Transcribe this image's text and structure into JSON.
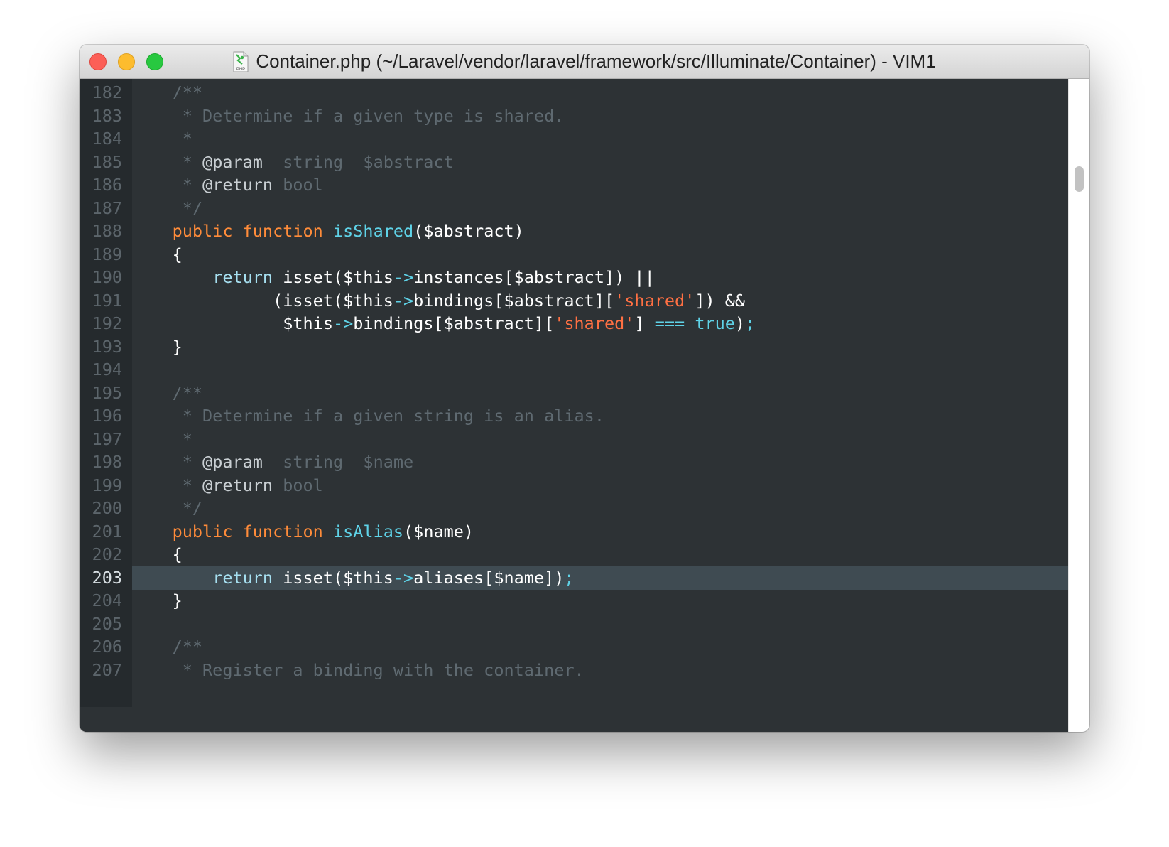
{
  "window": {
    "title": "Container.php (~/Laravel/vendor/laravel/framework/src/Illuminate/Container) - VIM1",
    "file_icon": "php-file-icon",
    "file_icon_label": "PHP"
  },
  "colors": {
    "editor_bg": "#2d3235",
    "gutter_bg": "#252a2d",
    "current_line_bg": "#3f4b52",
    "keyword": "#ff8c3a",
    "function_name": "#5fd3e8",
    "string": "#ff7043",
    "comment": "#5f6a71"
  },
  "editor": {
    "current_line": "203",
    "lines": [
      {
        "num": "182",
        "tokens": [
          {
            "t": "    /**",
            "c": "comment"
          }
        ]
      },
      {
        "num": "183",
        "tokens": [
          {
            "t": "     * Determine if a given type is shared.",
            "c": "comment"
          }
        ]
      },
      {
        "num": "184",
        "tokens": [
          {
            "t": "     *",
            "c": "comment"
          }
        ]
      },
      {
        "num": "185",
        "tokens": [
          {
            "t": "     * ",
            "c": "comment"
          },
          {
            "t": "@param",
            "c": "tag"
          },
          {
            "t": "  string  $abstract",
            "c": "comment"
          }
        ]
      },
      {
        "num": "186",
        "tokens": [
          {
            "t": "     * ",
            "c": "comment"
          },
          {
            "t": "@return",
            "c": "tag"
          },
          {
            "t": " bool",
            "c": "comment"
          }
        ]
      },
      {
        "num": "187",
        "tokens": [
          {
            "t": "     */",
            "c": "comment"
          }
        ]
      },
      {
        "num": "188",
        "tokens": [
          {
            "t": "    ",
            "c": "plain"
          },
          {
            "t": "public",
            "c": "kw"
          },
          {
            "t": " ",
            "c": "plain"
          },
          {
            "t": "function",
            "c": "kw"
          },
          {
            "t": " ",
            "c": "plain"
          },
          {
            "t": "isShared",
            "c": "fn"
          },
          {
            "t": "($abstract)",
            "c": "plain"
          }
        ]
      },
      {
        "num": "189",
        "tokens": [
          {
            "t": "    {",
            "c": "plain"
          }
        ]
      },
      {
        "num": "190",
        "tokens": [
          {
            "t": "        ",
            "c": "plain"
          },
          {
            "t": "return",
            "c": "ret"
          },
          {
            "t": " isset($this",
            "c": "plain"
          },
          {
            "t": "->",
            "c": "op"
          },
          {
            "t": "instances[$abstract]) ||",
            "c": "plain"
          }
        ]
      },
      {
        "num": "191",
        "tokens": [
          {
            "t": "              (isset($this",
            "c": "plain"
          },
          {
            "t": "->",
            "c": "op"
          },
          {
            "t": "bindings[$abstract][",
            "c": "plain"
          },
          {
            "t": "'shared'",
            "c": "str"
          },
          {
            "t": "]) &&",
            "c": "plain"
          }
        ]
      },
      {
        "num": "192",
        "tokens": [
          {
            "t": "               $this",
            "c": "plain"
          },
          {
            "t": "->",
            "c": "op"
          },
          {
            "t": "bindings[$abstract][",
            "c": "plain"
          },
          {
            "t": "'shared'",
            "c": "str"
          },
          {
            "t": "] ",
            "c": "plain"
          },
          {
            "t": "===",
            "c": "op"
          },
          {
            "t": " ",
            "c": "plain"
          },
          {
            "t": "true",
            "c": "fn"
          },
          {
            "t": ")",
            "c": "plain"
          },
          {
            "t": ";",
            "c": "op"
          }
        ]
      },
      {
        "num": "193",
        "tokens": [
          {
            "t": "    }",
            "c": "plain"
          }
        ]
      },
      {
        "num": "194",
        "tokens": []
      },
      {
        "num": "195",
        "tokens": [
          {
            "t": "    /**",
            "c": "comment"
          }
        ]
      },
      {
        "num": "196",
        "tokens": [
          {
            "t": "     * Determine if a given string is an alias.",
            "c": "comment"
          }
        ]
      },
      {
        "num": "197",
        "tokens": [
          {
            "t": "     *",
            "c": "comment"
          }
        ]
      },
      {
        "num": "198",
        "tokens": [
          {
            "t": "     * ",
            "c": "comment"
          },
          {
            "t": "@param",
            "c": "tag"
          },
          {
            "t": "  string  $name",
            "c": "comment"
          }
        ]
      },
      {
        "num": "199",
        "tokens": [
          {
            "t": "     * ",
            "c": "comment"
          },
          {
            "t": "@return",
            "c": "tag"
          },
          {
            "t": " bool",
            "c": "comment"
          }
        ]
      },
      {
        "num": "200",
        "tokens": [
          {
            "t": "     */",
            "c": "comment"
          }
        ]
      },
      {
        "num": "201",
        "tokens": [
          {
            "t": "    ",
            "c": "plain"
          },
          {
            "t": "public",
            "c": "kw"
          },
          {
            "t": " ",
            "c": "plain"
          },
          {
            "t": "function",
            "c": "kw"
          },
          {
            "t": " ",
            "c": "plain"
          },
          {
            "t": "isAlias",
            "c": "fn"
          },
          {
            "t": "($name)",
            "c": "plain"
          }
        ]
      },
      {
        "num": "202",
        "tokens": [
          {
            "t": "    {",
            "c": "plain"
          }
        ]
      },
      {
        "num": "203",
        "tokens": [
          {
            "t": "        ",
            "c": "plain"
          },
          {
            "t": "return",
            "c": "ret"
          },
          {
            "t": " isset($this",
            "c": "plain"
          },
          {
            "t": "->",
            "c": "op"
          },
          {
            "t": "aliases[$name])",
            "c": "plain"
          },
          {
            "t": ";",
            "c": "op"
          }
        ]
      },
      {
        "num": "204",
        "tokens": [
          {
            "t": "    }",
            "c": "plain"
          }
        ]
      },
      {
        "num": "205",
        "tokens": []
      },
      {
        "num": "206",
        "tokens": [
          {
            "t": "    /**",
            "c": "comment"
          }
        ]
      },
      {
        "num": "207",
        "tokens": [
          {
            "t": "     * Register a binding with the container.",
            "c": "comment"
          }
        ]
      }
    ]
  },
  "scrollbar": {
    "position_fraction": 0.11
  }
}
